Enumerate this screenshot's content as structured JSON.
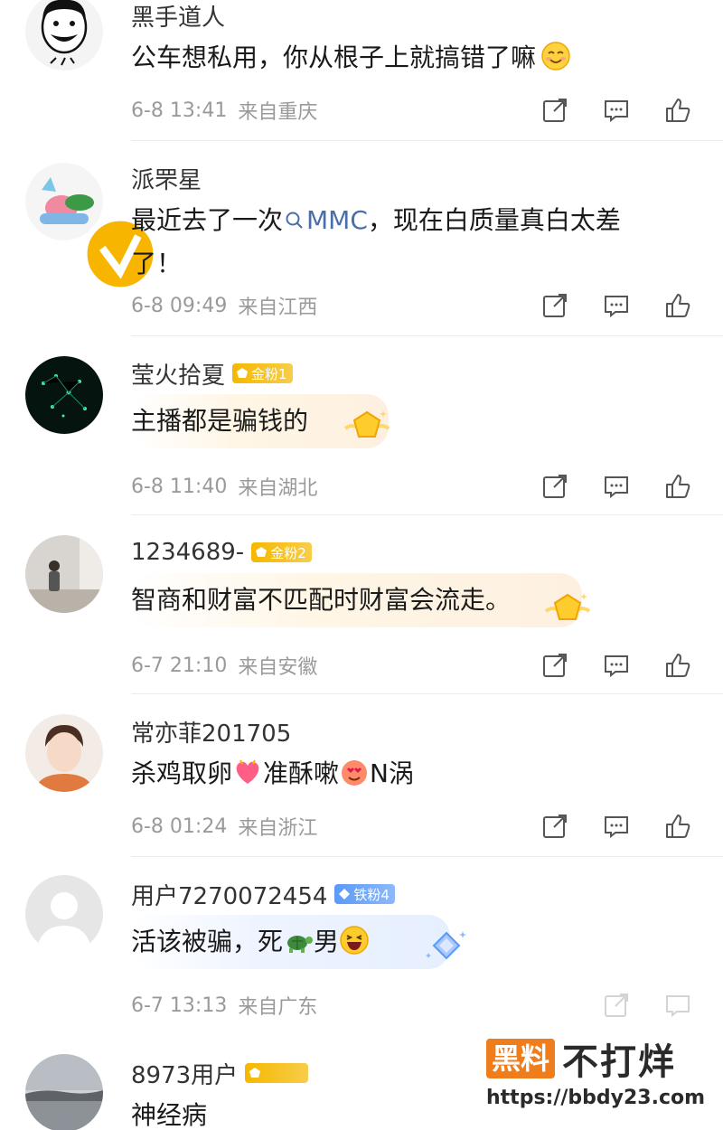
{
  "comments": [
    {
      "username": "黑手道人",
      "text": "公车想私用，你从根子上就搞错了嘛",
      "emoji": "smile-face",
      "time": "6-8 13:41",
      "location": "来自重庆"
    },
    {
      "username": "派罘星",
      "verified": true,
      "text_before": "最近去了一次",
      "link_text": "MMC",
      "text_after": "，现在白质量真白太差",
      "text_line2": "了！",
      "time": "6-8 09:49",
      "location": "来自江西"
    },
    {
      "username": "莹火拾夏",
      "badge": "金粉1",
      "text": "主播都是骗钱的",
      "time": "6-8 11:40",
      "location": "来自湖北"
    },
    {
      "username": "1234689-",
      "badge": "金粉2",
      "text": "智商和财富不匹配时财富会流走。",
      "time": "6-7 21:10",
      "location": "来自安徽"
    },
    {
      "username": "常亦菲201705",
      "text_part1": "杀鸡取卵",
      "text_part2": "准酥嗽",
      "text_part3": "N涡",
      "time": "6-8 01:24",
      "location": "来自浙江"
    },
    {
      "username": "用户7270072454",
      "badge": "铁粉4",
      "text_part1": "活该被骗，死",
      "text_part2": "男",
      "time": "6-7 13:13",
      "location": "来自广东"
    },
    {
      "username": "8973用户",
      "badge": "",
      "text": "神经病"
    }
  ],
  "watermark": {
    "box_text": "黑料",
    "text": "不打烊",
    "url": "https://bbdy23.com"
  },
  "colors": {
    "gold_badge": "#f5b800",
    "iron_badge": "#5a9af7",
    "meta_gray": "#9a9a9a",
    "link_blue": "#4a6ea8"
  }
}
